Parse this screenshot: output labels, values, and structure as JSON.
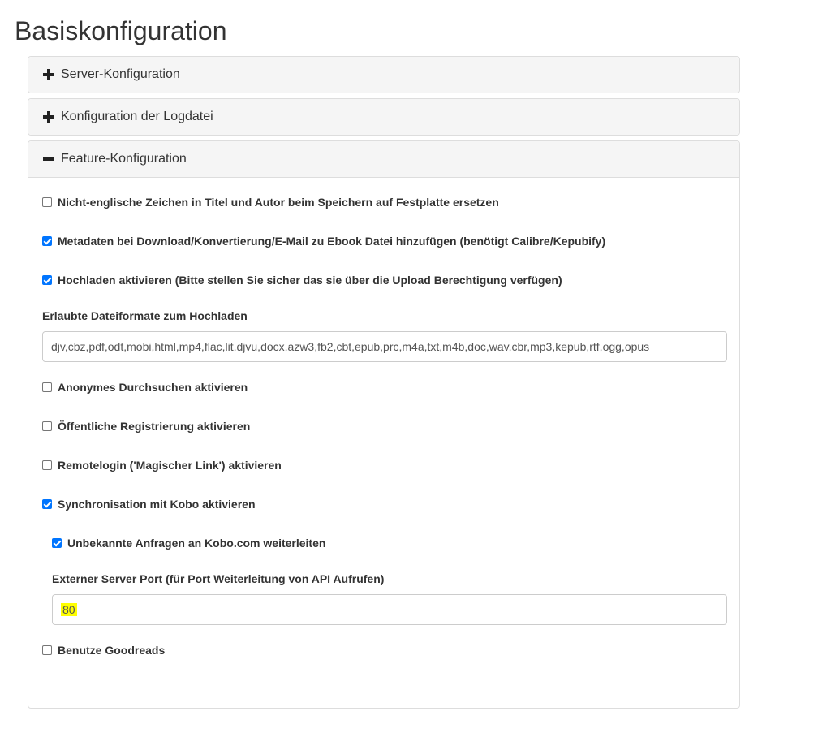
{
  "page": {
    "title": "Basiskonfiguration"
  },
  "panels": {
    "server": {
      "label": "Server-Konfiguration",
      "state": "collapsed"
    },
    "logfile": {
      "label": "Konfiguration der Logdatei",
      "state": "collapsed"
    },
    "feature": {
      "label": "Feature-Konfiguration",
      "state": "expanded"
    }
  },
  "feature": {
    "unicode_filenames": {
      "label": "Nicht-englische Zeichen in Titel und Autor beim Speichern auf Festplatte ersetzen",
      "checked": false
    },
    "embed_metadata": {
      "label": "Metadaten bei Download/Konvertierung/E-Mail zu Ebook Datei hinzufügen (benötigt Calibre/Kepubify)",
      "checked": true
    },
    "uploading": {
      "label": "Hochladen aktivieren (Bitte stellen Sie sicher das sie über die Upload Berechtigung verfügen)",
      "checked": true
    },
    "allowed_formats": {
      "label": "Erlaubte Dateiformate zum Hochladen",
      "value": "djv,cbz,pdf,odt,mobi,html,mp4,flac,lit,djvu,docx,azw3,fb2,cbt,epub,prc,m4a,txt,m4b,doc,wav,cbr,mp3,kepub,rtf,ogg,opus"
    },
    "anonymous_browse": {
      "label": "Anonymes Durchsuchen aktivieren",
      "checked": false
    },
    "public_registration": {
      "label": "Öffentliche Registrierung aktivieren",
      "checked": false
    },
    "remote_login": {
      "label": "Remotelogin ('Magischer Link') aktivieren",
      "checked": false
    },
    "kobo_sync": {
      "label": "Synchronisation mit Kobo aktivieren",
      "checked": true
    },
    "kobo_proxy": {
      "label": "Unbekannte Anfragen an Kobo.com weiterleiten",
      "checked": true
    },
    "external_port": {
      "label": "Externer Server Port (für Port Weiterleitung von API Aufrufen)",
      "value": "80"
    },
    "goodreads": {
      "label": "Benutze Goodreads",
      "checked": false
    }
  },
  "colors": {
    "checkbox_checked": "#0075ff",
    "highlight": "#ffff00",
    "panel_heading_bg": "#f5f5f5"
  }
}
